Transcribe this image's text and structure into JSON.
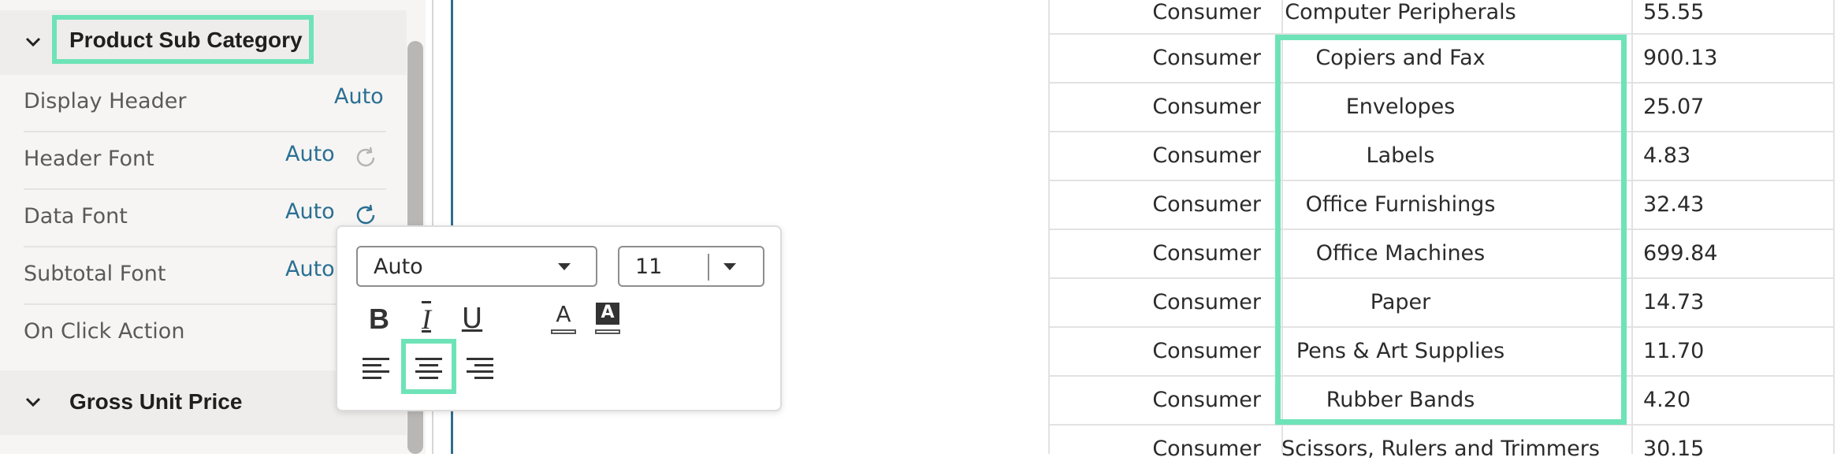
{
  "properties_panel": {
    "sections": [
      {
        "title": "Product Sub Category",
        "expanded": true
      },
      {
        "title": "Gross Unit Price",
        "expanded": true
      }
    ],
    "rows": [
      {
        "label": "Display Header",
        "value": "Auto"
      },
      {
        "label": "Header Font",
        "value": "Auto"
      },
      {
        "label": "Data Font",
        "value": "Auto"
      },
      {
        "label": "Subtotal Font",
        "value": "Auto"
      },
      {
        "label": "On Click Action",
        "value": ""
      }
    ]
  },
  "font_popover": {
    "font_family": "Auto",
    "font_size": "11",
    "style_buttons": {
      "bold": "B",
      "italic": "I",
      "underline": "U",
      "font_color": "A",
      "background_color": "A"
    },
    "alignment": {
      "options": [
        "left",
        "center",
        "right"
      ],
      "selected": "center"
    }
  },
  "table": {
    "rows": [
      {
        "segment": "Consumer",
        "sub_category": "Computer Peripherals",
        "value": "55.55"
      },
      {
        "segment": "Consumer",
        "sub_category": "Copiers and Fax",
        "value": "900.13"
      },
      {
        "segment": "Consumer",
        "sub_category": "Envelopes",
        "value": "25.07"
      },
      {
        "segment": "Consumer",
        "sub_category": "Labels",
        "value": "4.83"
      },
      {
        "segment": "Consumer",
        "sub_category": "Office Furnishings",
        "value": "32.43"
      },
      {
        "segment": "Consumer",
        "sub_category": "Office Machines",
        "value": "699.84"
      },
      {
        "segment": "Consumer",
        "sub_category": "Paper",
        "value": "14.73"
      },
      {
        "segment": "Consumer",
        "sub_category": "Pens & Art Supplies",
        "value": "11.70"
      },
      {
        "segment": "Consumer",
        "sub_category": "Rubber Bands",
        "value": "4.20"
      },
      {
        "segment": "Consumer",
        "sub_category": "Scissors, Rulers and Trimmers",
        "value": "30.15"
      }
    ]
  },
  "colors": {
    "highlight": "#6ee3b8",
    "link_value": "#2a6f93"
  }
}
